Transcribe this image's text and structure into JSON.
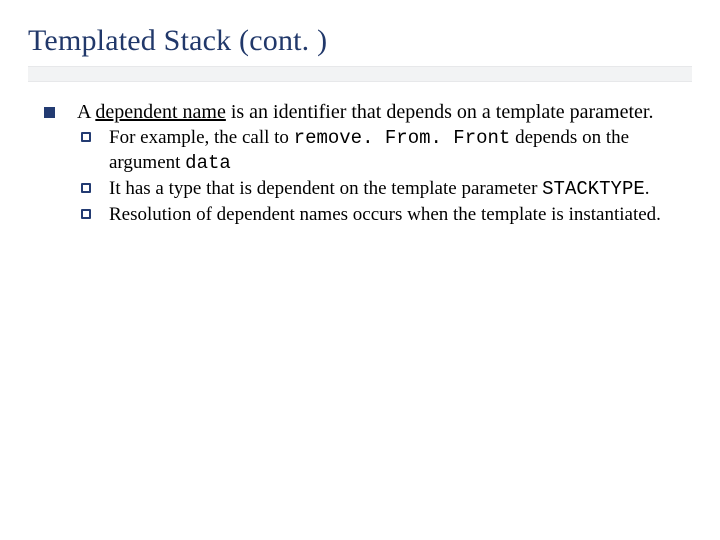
{
  "title": "Templated Stack (cont. )",
  "bullet1": {
    "pre": "A ",
    "term": "dependent name",
    "post": " is an identifier that depends on a template parameter."
  },
  "sub": [
    {
      "a": "For example, the call to ",
      "code1": "remove. From. Front",
      "b": " depends on the argument ",
      "code2": "data"
    },
    {
      "a": "It has a type that is dependent on the template parameter ",
      "code1": "STACKTYPE",
      "b": ".",
      "code2": ""
    },
    {
      "a": "Resolution of dependent names occurs when the template is instantiated.",
      "code1": "",
      "b": "",
      "code2": ""
    }
  ]
}
